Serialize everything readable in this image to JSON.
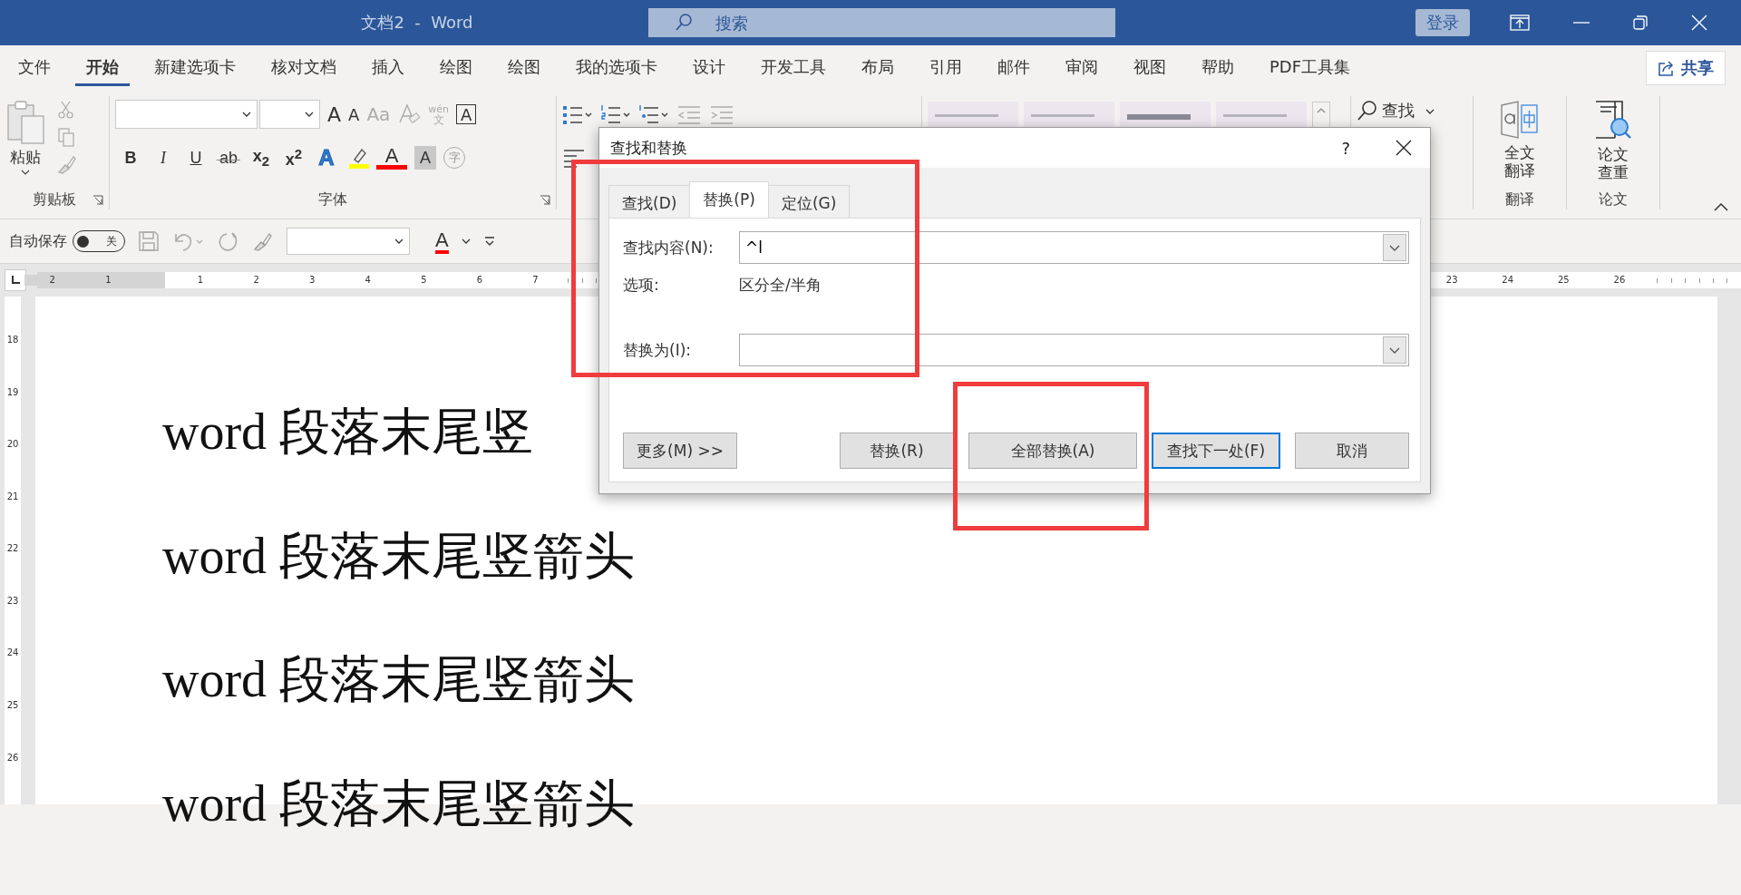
{
  "window": {
    "title": "文档2  -  Word",
    "search_placeholder": "搜索",
    "login": "登录"
  },
  "tabs": [
    {
      "label": "文件",
      "selected": false
    },
    {
      "label": "开始",
      "selected": true
    },
    {
      "label": "新建选项卡",
      "selected": false
    },
    {
      "label": "核对文档",
      "selected": false
    },
    {
      "label": "插入",
      "selected": false
    },
    {
      "label": "绘图",
      "selected": false
    },
    {
      "label": "绘图",
      "selected": false
    },
    {
      "label": "我的选项卡",
      "selected": false
    },
    {
      "label": "设计",
      "selected": false
    },
    {
      "label": "开发工具",
      "selected": false
    },
    {
      "label": "布局",
      "selected": false
    },
    {
      "label": "引用",
      "selected": false
    },
    {
      "label": "邮件",
      "selected": false
    },
    {
      "label": "审阅",
      "selected": false
    },
    {
      "label": "视图",
      "selected": false
    },
    {
      "label": "帮助",
      "selected": false
    },
    {
      "label": "PDF工具集",
      "selected": false
    }
  ],
  "share": "共享",
  "ribbon": {
    "clipboard": {
      "paste": "粘贴",
      "label": "剪贴板"
    },
    "font": {
      "label": "字体",
      "row1": [
        "A",
        "A",
        "Aa"
      ],
      "wen": "wén",
      "wen_sub": "文",
      "box_a": "A",
      "row2": [
        {
          "kind": "bold",
          "text": "B"
        },
        {
          "kind": "italic",
          "text": "I"
        },
        {
          "kind": "underline",
          "text": "U"
        },
        {
          "kind": "strike",
          "text": "ab"
        },
        {
          "kind": "sub",
          "text": "x$_{2}$"
        },
        {
          "kind": "sup",
          "text": "x$^{2}$"
        },
        {
          "kind": "effect",
          "text": "A"
        },
        {
          "kind": "highlight"
        },
        {
          "kind": "color",
          "text": "A"
        },
        {
          "kind": "shade",
          "text": "A"
        },
        {
          "kind": "circle",
          "text": "字"
        }
      ]
    },
    "find": "查找",
    "translate": {
      "button": "全文翻译",
      "label": "翻译"
    },
    "paper": {
      "button": "论文查重",
      "label": "论文"
    }
  },
  "quick_access": {
    "autosave": "自动保存",
    "autosave_on": false,
    "off_label": "关",
    "font_color": "A"
  },
  "ruler": {
    "left_numbers": [
      "2",
      "1"
    ],
    "numbers": [
      "1",
      "2",
      "3",
      "4",
      "5",
      "6",
      "7"
    ],
    "right_numbers": [
      "23",
      "24",
      "25",
      "26"
    ],
    "vertical_numbers": [
      "18",
      "19",
      "20",
      "21",
      "22",
      "23",
      "24",
      "25",
      "26"
    ]
  },
  "document": {
    "lines": [
      "word 段落末尾竖",
      "word 段落末尾竖箭头",
      "word 段落末尾竖箭头",
      "word 段落末尾竖箭头"
    ]
  },
  "dialog": {
    "title": "查找和替换",
    "help": "?",
    "tabs": [
      {
        "label": "查找(D)",
        "selected": false
      },
      {
        "label": "替换(P)",
        "selected": true
      },
      {
        "label": "定位(G)",
        "selected": false
      }
    ],
    "find_label": "查找内容(N):",
    "find_value": "^l",
    "options_label": "选项:",
    "options_value": "区分全/半角",
    "replace_label": "替换为(I):",
    "buttons": [
      {
        "label": "更多(M) >>",
        "kind": "more",
        "focused": false
      },
      {
        "label": "替换(R)",
        "kind": "action",
        "focused": false
      },
      {
        "label": "全部替换(A)",
        "kind": "action",
        "focused": false
      },
      {
        "label": "查找下一处(F)",
        "kind": "action",
        "focused": true
      },
      {
        "label": "取消",
        "kind": "action",
        "focused": false
      }
    ]
  }
}
